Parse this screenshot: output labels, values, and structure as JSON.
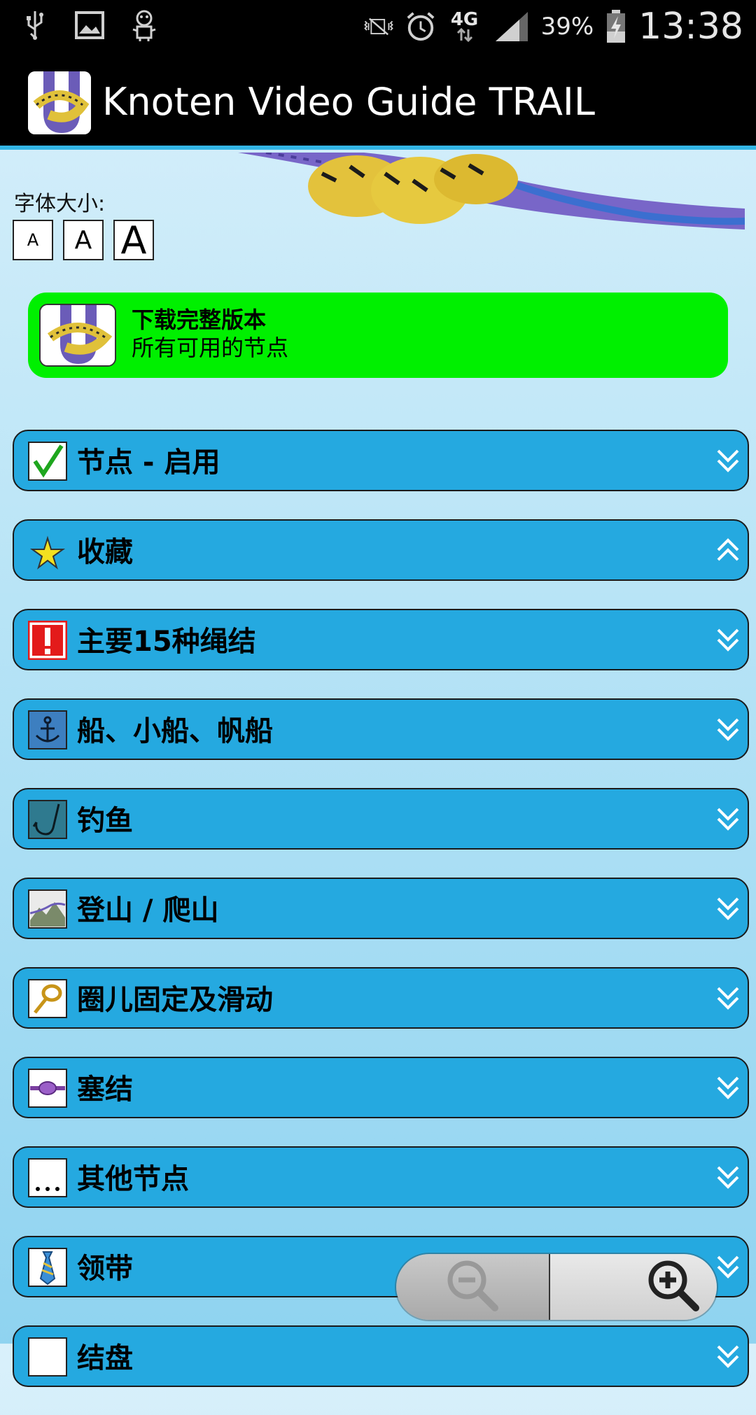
{
  "status_bar": {
    "time": "13:38",
    "battery_percent": "39%",
    "network": "4G",
    "left_icons": [
      "usb-icon",
      "image-icon",
      "robot-icon"
    ],
    "right_icons": [
      "vibrate-icon",
      "alarm-icon",
      "network-4g-icon",
      "signal-icon",
      "battery-charging-icon"
    ]
  },
  "app_bar": {
    "title": "Knoten Video Guide TRAIL",
    "icon": "knot-app-icon"
  },
  "font_size": {
    "label": "字体大小:",
    "options": [
      "A",
      "A",
      "A"
    ]
  },
  "download_banner": {
    "title": "下载完整版本",
    "subtitle": "所有可用的节点",
    "background": "#00f000"
  },
  "categories": [
    {
      "label": "节点 - 启用",
      "icon": "checkmark-icon",
      "expanded": false
    },
    {
      "label": "收藏",
      "icon": "star-icon",
      "expanded": true
    },
    {
      "label": "主要15种绳结",
      "icon": "exclamation-icon",
      "expanded": false
    },
    {
      "label": "船、小船、帆船",
      "icon": "anchor-icon",
      "expanded": false
    },
    {
      "label": "钓鱼",
      "icon": "fishing-hook-icon",
      "expanded": false
    },
    {
      "label": "登山 / 爬山",
      "icon": "mountain-icon",
      "expanded": false
    },
    {
      "label": "圈儿固定及滑动",
      "icon": "loop-knot-icon",
      "expanded": false
    },
    {
      "label": "塞结",
      "icon": "stopper-knot-icon",
      "expanded": false
    },
    {
      "label": "其他节点",
      "icon": "ellipsis-icon",
      "expanded": false
    },
    {
      "label": "领带",
      "icon": "necktie-icon",
      "expanded": false
    },
    {
      "label": "结盘",
      "icon": "decorative-knot-icon",
      "expanded": false
    }
  ],
  "zoom": {
    "out_icon": "zoom-out-icon",
    "in_icon": "zoom-in-icon"
  },
  "colors": {
    "accent": "#33b5e5",
    "category_row": "#25a9e0",
    "download_green": "#00f000"
  }
}
